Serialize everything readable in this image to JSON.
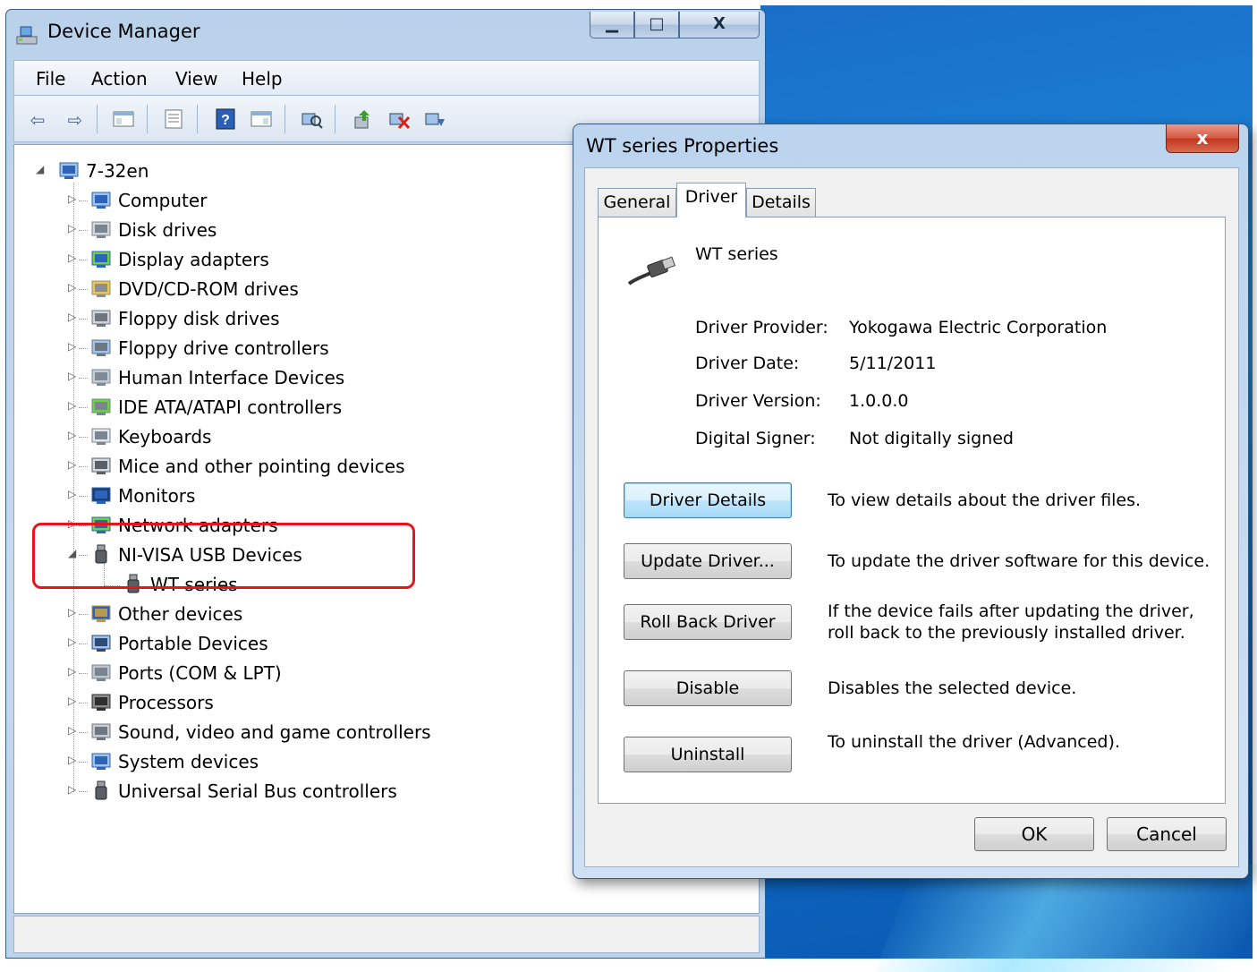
{
  "device_manager": {
    "title": "Device Manager",
    "caption_buttons": {
      "minimize": "▁",
      "maximize": "□",
      "close": "X"
    },
    "menu": [
      "File",
      "Action",
      "View",
      "Help"
    ],
    "tree": {
      "root": "7-32en",
      "categories": [
        {
          "label": "Computer",
          "icon": "computer-icon"
        },
        {
          "label": "Disk drives",
          "icon": "disk-drive-icon"
        },
        {
          "label": "Display adapters",
          "icon": "display-adapter-icon"
        },
        {
          "label": "DVD/CD-ROM drives",
          "icon": "dvd-drive-icon"
        },
        {
          "label": "Floppy disk drives",
          "icon": "floppy-icon"
        },
        {
          "label": "Floppy drive controllers",
          "icon": "floppy-controller-icon"
        },
        {
          "label": "Human Interface Devices",
          "icon": "hid-icon"
        },
        {
          "label": "IDE ATA/ATAPI controllers",
          "icon": "ide-icon"
        },
        {
          "label": "Keyboards",
          "icon": "keyboard-icon"
        },
        {
          "label": "Mice and other pointing devices",
          "icon": "mouse-icon"
        },
        {
          "label": "Monitors",
          "icon": "monitor-icon"
        },
        {
          "label": "Network adapters",
          "icon": "network-adapter-icon"
        },
        {
          "label": "NI-VISA USB Devices",
          "icon": "usb-plug-icon",
          "expanded": true,
          "children": [
            "WT series"
          ]
        },
        {
          "label": "Other devices",
          "icon": "unknown-device-icon"
        },
        {
          "label": "Portable Devices",
          "icon": "portable-device-icon"
        },
        {
          "label": "Ports (COM & LPT)",
          "icon": "port-icon"
        },
        {
          "label": "Processors",
          "icon": "processor-icon"
        },
        {
          "label": "Sound, video and game controllers",
          "icon": "speaker-icon"
        },
        {
          "label": "System devices",
          "icon": "system-device-icon"
        },
        {
          "label": "Universal Serial Bus controllers",
          "icon": "usb-plug-icon"
        }
      ]
    }
  },
  "dialog": {
    "title": "WT series Properties",
    "close": "x",
    "tabs": [
      "General",
      "Driver",
      "Details"
    ],
    "active_tab": "Driver",
    "device_name": "WT series",
    "info": [
      {
        "label": "Driver Provider:",
        "value": "Yokogawa Electric Corporation"
      },
      {
        "label": "Driver Date:",
        "value": "5/11/2011"
      },
      {
        "label": "Driver Version:",
        "value": "1.0.0.0"
      },
      {
        "label": "Digital Signer:",
        "value": "Not digitally signed"
      }
    ],
    "actions": [
      {
        "button": "Driver Details",
        "description": "To view details about the driver files."
      },
      {
        "button": "Update Driver...",
        "description": "To update the driver software for this device."
      },
      {
        "button": "Roll Back Driver",
        "description": "If the device fails after updating the driver, roll back to the previously installed driver."
      },
      {
        "button": "Disable",
        "description": "Disables the selected device."
      },
      {
        "button": "Uninstall",
        "description": "To uninstall the driver (Advanced)."
      }
    ],
    "footer": {
      "ok": "OK",
      "cancel": "Cancel"
    }
  },
  "colors": {
    "highlight_border": "#e8141c",
    "title_bar": "#bcd4ee",
    "close_button": "#c2351c",
    "focus_button": "#bee6fd"
  }
}
